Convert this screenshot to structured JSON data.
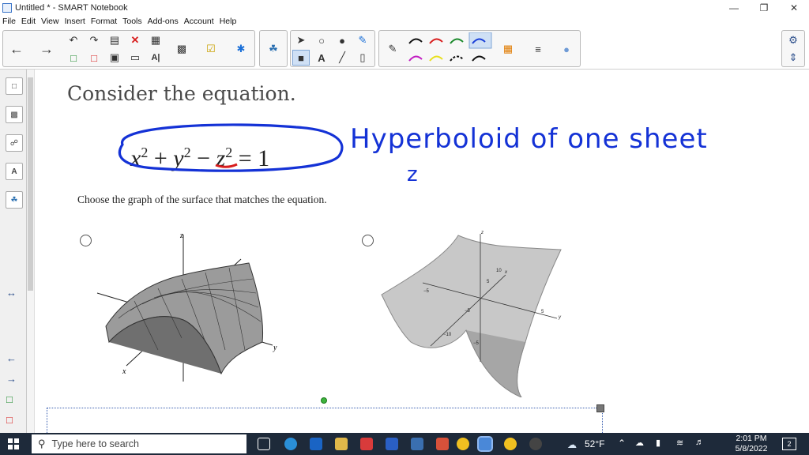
{
  "window": {
    "title": "Untitled * - SMART Notebook",
    "controls": {
      "minimize": "—",
      "restore": "❐",
      "close": "✕"
    }
  },
  "menu": [
    "File",
    "Edit",
    "View",
    "Insert",
    "Format",
    "Tools",
    "Add-ons",
    "Account",
    "Help"
  ],
  "toolbar": {
    "icons": [
      "back-arrow-icon",
      "forward-arrow-icon",
      "undo-icon",
      "redo-icon",
      "paste-icon",
      "delete-icon",
      "table-icon",
      "screen-shade-icon",
      "add-page-icon",
      "clone-icon",
      "save-icon",
      "present-icon",
      "text-icon",
      "capture-icon",
      "activity-icon",
      "addon-icon",
      "select-icon",
      "shapes-icon",
      "fill-icon",
      "magic-pen-icon",
      "line-icon",
      "eraser-icon",
      "pen-icon",
      "properties-icon",
      "settings-icon"
    ],
    "pen_colors": [
      "#111111",
      "#d81e1e",
      "#1c8a2c",
      "#1a3fd8",
      "#c21ec2",
      "#e8e020",
      "#111111",
      "#111111"
    ]
  },
  "page": {
    "heading": "Consider the equation.",
    "equation": {
      "x": "x",
      "y": "y",
      "op1": "+",
      "op2": "−",
      "z": "z",
      "eq": "=",
      "one": "1",
      "exp": "2"
    },
    "annotation": "Hyperboloid of one sheet",
    "annotation_small": "z",
    "prompt": "Choose the graph of the surface that matches the equation.",
    "graph_left": {
      "axis_z": "z",
      "axis_x": "x",
      "axis_y": "y"
    },
    "graph_right": {
      "axis_z": "z",
      "axis_x": "x",
      "axis_y": "y",
      "tick_labels": [
        "10",
        "5",
        "−5",
        "−5",
        "5",
        "−10",
        "−5"
      ]
    }
  },
  "taskbar": {
    "search_placeholder": "Type here to search",
    "weather": "52°F",
    "time": "2:01 PM",
    "date": "5/8/2022",
    "notifications": "2"
  },
  "colors": {
    "ink_blue": "#1432d6",
    "ink_red": "#d81e1e",
    "taskbar": "#1e2a3a"
  }
}
